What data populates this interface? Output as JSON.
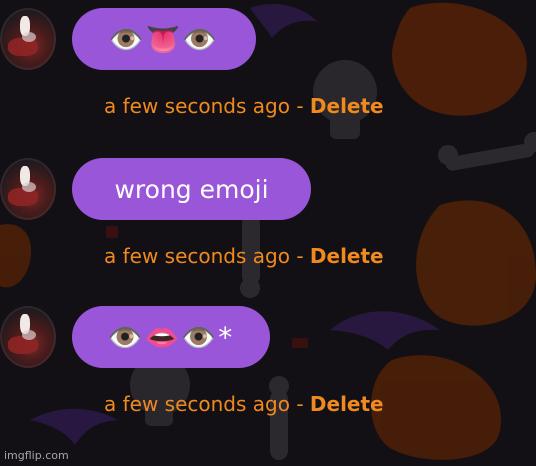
{
  "messages": [
    {
      "content": "👁️👅👁️",
      "timestamp": "a few seconds ago",
      "separator": " - ",
      "action": "Delete"
    },
    {
      "content": "wrong emoji",
      "timestamp": "a few seconds ago",
      "separator": " - ",
      "action": "Delete"
    },
    {
      "content": "👁️👄👁️*",
      "timestamp": "a few seconds ago",
      "separator": " - ",
      "action": "Delete"
    }
  ],
  "watermark": "imgflip.com",
  "colors": {
    "background": "#121015",
    "bubble": "#9a56d9",
    "meta_text": "#f08a1f",
    "message_text": "#ffffff",
    "decoration_orange": "#5a2509",
    "decoration_purple": "#2c1a44",
    "decoration_bone": "#2d2b30"
  },
  "icons": [
    "avatar-image",
    "skull-decoration",
    "bone-decoration",
    "bat-decoration",
    "pumpkin-decoration"
  ]
}
